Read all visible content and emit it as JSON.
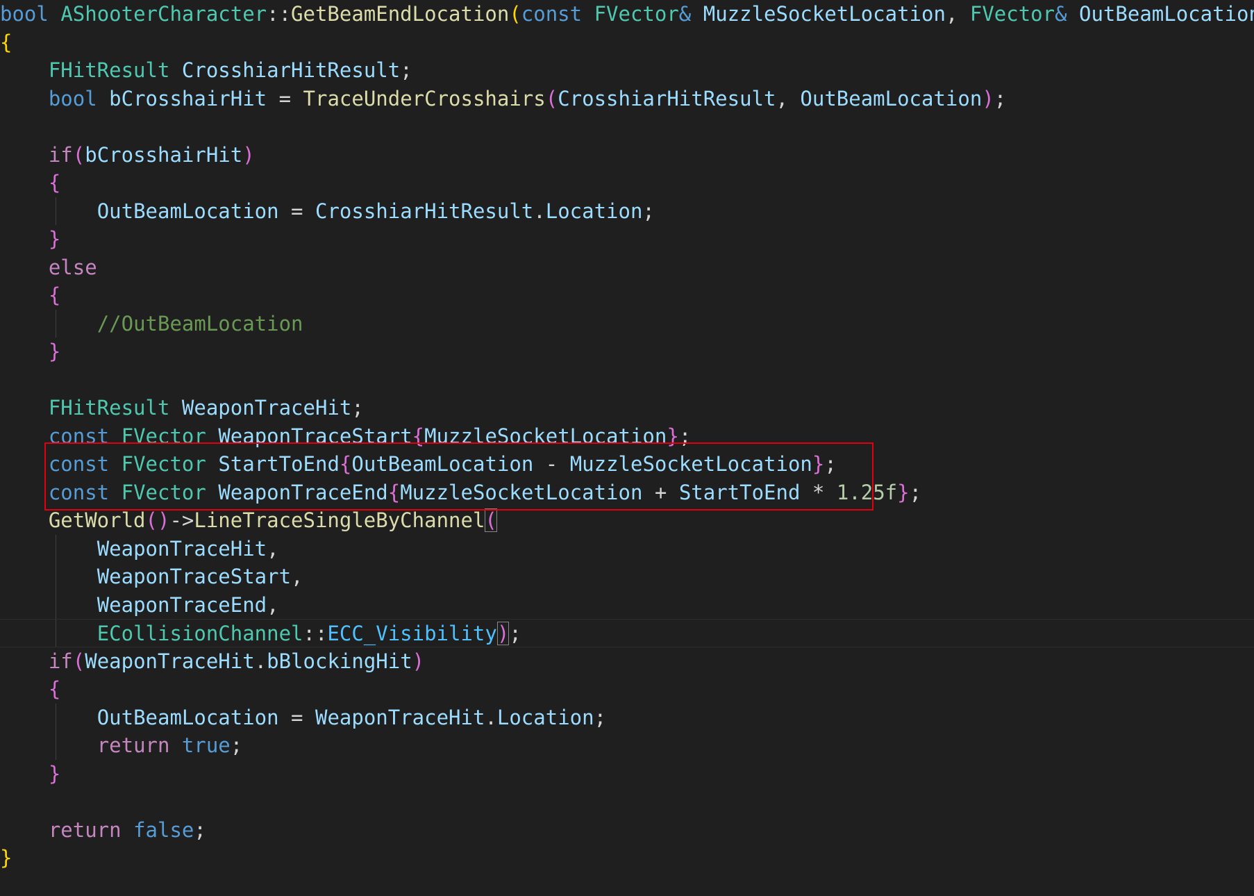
{
  "colors": {
    "background": "#1f1f1f",
    "current_line_border": "#2e2e2e",
    "indent_guide": "#404040",
    "highlight_box": "#e3000f",
    "keyword": "#569cd6",
    "control": "#c586c0",
    "type": "#4ec9b0",
    "function": "#dcdcaa",
    "variable": "#9cdcfe",
    "enum_member": "#4fc1ff",
    "number": "#b5cea8",
    "comment": "#6a9955",
    "plain": "#d4d4d4",
    "bracket_level1": "#ffd700",
    "bracket_level2": "#da70d6",
    "bracket_level3": "#179fff"
  },
  "editor": {
    "current_line": 22,
    "highlight_box_lines": [
      17,
      18
    ],
    "lines": [
      [
        [
          "bool",
          "keyword"
        ],
        [
          " ",
          "plain"
        ],
        [
          "AShooterCharacter",
          "type"
        ],
        [
          "::",
          "plain"
        ],
        [
          "GetBeamEndLocation",
          "function"
        ],
        [
          "(",
          "bracket_level1"
        ],
        [
          "const",
          "keyword"
        ],
        [
          " ",
          "plain"
        ],
        [
          "FVector",
          "type"
        ],
        [
          "&",
          "keyword"
        ],
        [
          " ",
          "plain"
        ],
        [
          "MuzzleSocketLocation",
          "variable"
        ],
        [
          ", ",
          "plain"
        ],
        [
          "FVector",
          "type"
        ],
        [
          "&",
          "keyword"
        ],
        [
          " ",
          "plain"
        ],
        [
          "OutBeamLocation",
          "variable"
        ],
        [
          ")",
          "bracket_level1"
        ]
      ],
      [
        [
          "{",
          "bracket_level1"
        ]
      ],
      [
        [
          "    ",
          "plain"
        ],
        [
          "FHitResult",
          "type"
        ],
        [
          " ",
          "plain"
        ],
        [
          "CrosshiarHitResult",
          "variable"
        ],
        [
          ";",
          "plain"
        ]
      ],
      [
        [
          "    ",
          "plain"
        ],
        [
          "bool",
          "keyword"
        ],
        [
          " ",
          "plain"
        ],
        [
          "bCrosshairHit",
          "variable"
        ],
        [
          " = ",
          "plain"
        ],
        [
          "TraceUnderCrosshairs",
          "function"
        ],
        [
          "(",
          "bracket_level2"
        ],
        [
          "CrosshiarHitResult",
          "variable"
        ],
        [
          ", ",
          "plain"
        ],
        [
          "OutBeamLocation",
          "variable"
        ],
        [
          ")",
          "bracket_level2"
        ],
        [
          ";",
          "plain"
        ]
      ],
      [],
      [
        [
          "    ",
          "plain"
        ],
        [
          "if",
          "control"
        ],
        [
          "(",
          "bracket_level2"
        ],
        [
          "bCrosshairHit",
          "variable"
        ],
        [
          ")",
          "bracket_level2"
        ]
      ],
      [
        [
          "    ",
          "plain"
        ],
        [
          "{",
          "bracket_level2"
        ]
      ],
      [
        [
          "        ",
          "plain"
        ],
        [
          "OutBeamLocation",
          "variable"
        ],
        [
          " = ",
          "plain"
        ],
        [
          "CrosshiarHitResult",
          "variable"
        ],
        [
          ".",
          "plain"
        ],
        [
          "Location",
          "variable"
        ],
        [
          ";",
          "plain"
        ]
      ],
      [
        [
          "    ",
          "plain"
        ],
        [
          "}",
          "bracket_level2"
        ]
      ],
      [
        [
          "    ",
          "plain"
        ],
        [
          "else",
          "control"
        ]
      ],
      [
        [
          "    ",
          "plain"
        ],
        [
          "{",
          "bracket_level2"
        ]
      ],
      [
        [
          "        ",
          "plain"
        ],
        [
          "//OutBeamLocation",
          "comment"
        ]
      ],
      [
        [
          "    ",
          "plain"
        ],
        [
          "}",
          "bracket_level2"
        ]
      ],
      [],
      [
        [
          "    ",
          "plain"
        ],
        [
          "FHitResult",
          "type"
        ],
        [
          " ",
          "plain"
        ],
        [
          "WeaponTraceHit",
          "variable"
        ],
        [
          ";",
          "plain"
        ]
      ],
      [
        [
          "    ",
          "plain"
        ],
        [
          "const",
          "keyword"
        ],
        [
          " ",
          "plain"
        ],
        [
          "FVector",
          "type"
        ],
        [
          " ",
          "plain"
        ],
        [
          "WeaponTraceStart",
          "variable"
        ],
        [
          "{",
          "bracket_level2"
        ],
        [
          "MuzzleSocketLocation",
          "variable"
        ],
        [
          "}",
          "bracket_level2"
        ],
        [
          ";",
          "plain"
        ]
      ],
      [
        [
          "    ",
          "plain"
        ],
        [
          "const",
          "keyword"
        ],
        [
          " ",
          "plain"
        ],
        [
          "FVector",
          "type"
        ],
        [
          " ",
          "plain"
        ],
        [
          "StartToEnd",
          "variable"
        ],
        [
          "{",
          "bracket_level2"
        ],
        [
          "OutBeamLocation",
          "variable"
        ],
        [
          " - ",
          "plain"
        ],
        [
          "MuzzleSocketLocation",
          "variable"
        ],
        [
          "}",
          "bracket_level2"
        ],
        [
          ";",
          "plain"
        ]
      ],
      [
        [
          "    ",
          "plain"
        ],
        [
          "const",
          "keyword"
        ],
        [
          " ",
          "plain"
        ],
        [
          "FVector",
          "type"
        ],
        [
          " ",
          "plain"
        ],
        [
          "WeaponTraceEnd",
          "variable"
        ],
        [
          "{",
          "bracket_level2"
        ],
        [
          "MuzzleSocketLocation",
          "variable"
        ],
        [
          " + ",
          "plain"
        ],
        [
          "StartToEnd",
          "variable"
        ],
        [
          " * ",
          "plain"
        ],
        [
          "1.25f",
          "number"
        ],
        [
          "}",
          "bracket_level2"
        ],
        [
          ";",
          "plain"
        ]
      ],
      [
        [
          "    ",
          "plain"
        ],
        [
          "GetWorld",
          "function"
        ],
        [
          "()",
          "bracket_level2"
        ],
        [
          "->",
          "plain"
        ],
        [
          "LineTraceSingleByChannel",
          "function"
        ],
        [
          "(",
          "bracket_level2",
          "match"
        ]
      ],
      [
        [
          "        ",
          "plain"
        ],
        [
          "WeaponTraceHit",
          "variable"
        ],
        [
          ",",
          "plain"
        ]
      ],
      [
        [
          "        ",
          "plain"
        ],
        [
          "WeaponTraceStart",
          "variable"
        ],
        [
          ",",
          "plain"
        ]
      ],
      [
        [
          "        ",
          "plain"
        ],
        [
          "WeaponTraceEnd",
          "variable"
        ],
        [
          ",",
          "plain"
        ]
      ],
      [
        [
          "        ",
          "plain"
        ],
        [
          "ECollisionChannel",
          "type"
        ],
        [
          "::",
          "plain"
        ],
        [
          "ECC_Visibility",
          "enum_member"
        ],
        [
          ")",
          "bracket_level2",
          "match"
        ],
        [
          ";",
          "plain"
        ]
      ],
      [
        [
          "    ",
          "plain"
        ],
        [
          "if",
          "control"
        ],
        [
          "(",
          "bracket_level2"
        ],
        [
          "WeaponTraceHit",
          "variable"
        ],
        [
          ".",
          "plain"
        ],
        [
          "bBlockingHit",
          "variable"
        ],
        [
          ")",
          "bracket_level2"
        ]
      ],
      [
        [
          "    ",
          "plain"
        ],
        [
          "{",
          "bracket_level2"
        ]
      ],
      [
        [
          "        ",
          "plain"
        ],
        [
          "OutBeamLocation",
          "variable"
        ],
        [
          " = ",
          "plain"
        ],
        [
          "WeaponTraceHit",
          "variable"
        ],
        [
          ".",
          "plain"
        ],
        [
          "Location",
          "variable"
        ],
        [
          ";",
          "plain"
        ]
      ],
      [
        [
          "        ",
          "plain"
        ],
        [
          "return",
          "control"
        ],
        [
          " ",
          "plain"
        ],
        [
          "true",
          "keyword"
        ],
        [
          ";",
          "plain"
        ]
      ],
      [
        [
          "    ",
          "plain"
        ],
        [
          "}",
          "bracket_level2"
        ]
      ],
      [],
      [
        [
          "    ",
          "plain"
        ],
        [
          "return",
          "control"
        ],
        [
          " ",
          "plain"
        ],
        [
          "false",
          "keyword"
        ],
        [
          ";",
          "plain"
        ]
      ],
      [
        [
          "}",
          "bracket_level1"
        ]
      ]
    ]
  }
}
